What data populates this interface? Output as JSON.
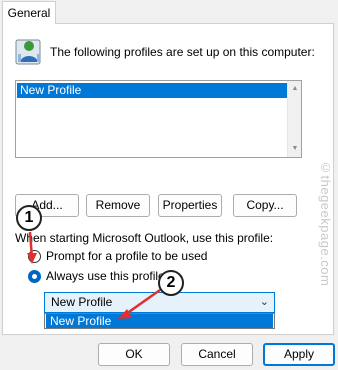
{
  "tab": {
    "general": "General"
  },
  "intro_text": "The following profiles are set up on this computer:",
  "profiles_list": [
    "New Profile"
  ],
  "scroll": {
    "up_icon": "▲",
    "down_icon": "▼"
  },
  "buttons": {
    "add": "Add...",
    "remove": "Remove",
    "properties": "Properties",
    "copy": "Copy..."
  },
  "startup_label": "When starting Microsoft Outlook, use this profile:",
  "radio": {
    "prompt": "Prompt for a profile to be used",
    "always": "Always use this profile"
  },
  "profile_select": {
    "value": "New Profile",
    "chevron": "⌄",
    "options": [
      "New Profile"
    ]
  },
  "dialog_buttons": {
    "ok": "OK",
    "cancel": "Cancel",
    "apply": "Apply"
  },
  "markers": [
    "1",
    "2"
  ],
  "watermark": "©thegeekpage.com",
  "colors": {
    "accent": "#0078d7",
    "annotation": "#e03030"
  }
}
